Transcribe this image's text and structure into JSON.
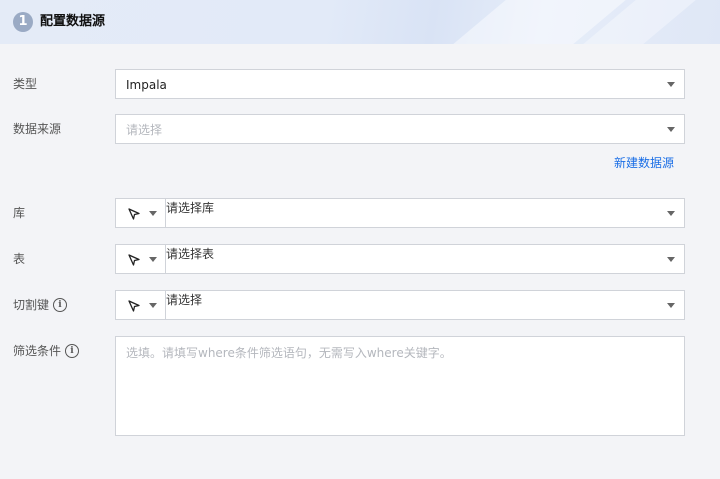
{
  "header": {
    "step": "1",
    "title": "配置数据源"
  },
  "form": {
    "type": {
      "label": "类型",
      "value": "Impala"
    },
    "datasource": {
      "label": "数据来源",
      "placeholder": "请选择"
    },
    "new_datasource_link": "新建数据源",
    "database": {
      "label": "库",
      "placeholder": "请选择库"
    },
    "table": {
      "label": "表",
      "placeholder": "请选择表"
    },
    "split_key": {
      "label": "切割键",
      "placeholder": "请选择"
    },
    "filter": {
      "label": "筛选条件",
      "placeholder": "选填。请填写where条件筛选语句，无需写入where关键字。"
    }
  },
  "icons": {
    "info": "info-icon",
    "pointer": "cursor-pointer-icon",
    "dropdown": "chevron-down-icon"
  },
  "colors": {
    "link": "#1a6ee6",
    "badge": "#9aaac4"
  }
}
